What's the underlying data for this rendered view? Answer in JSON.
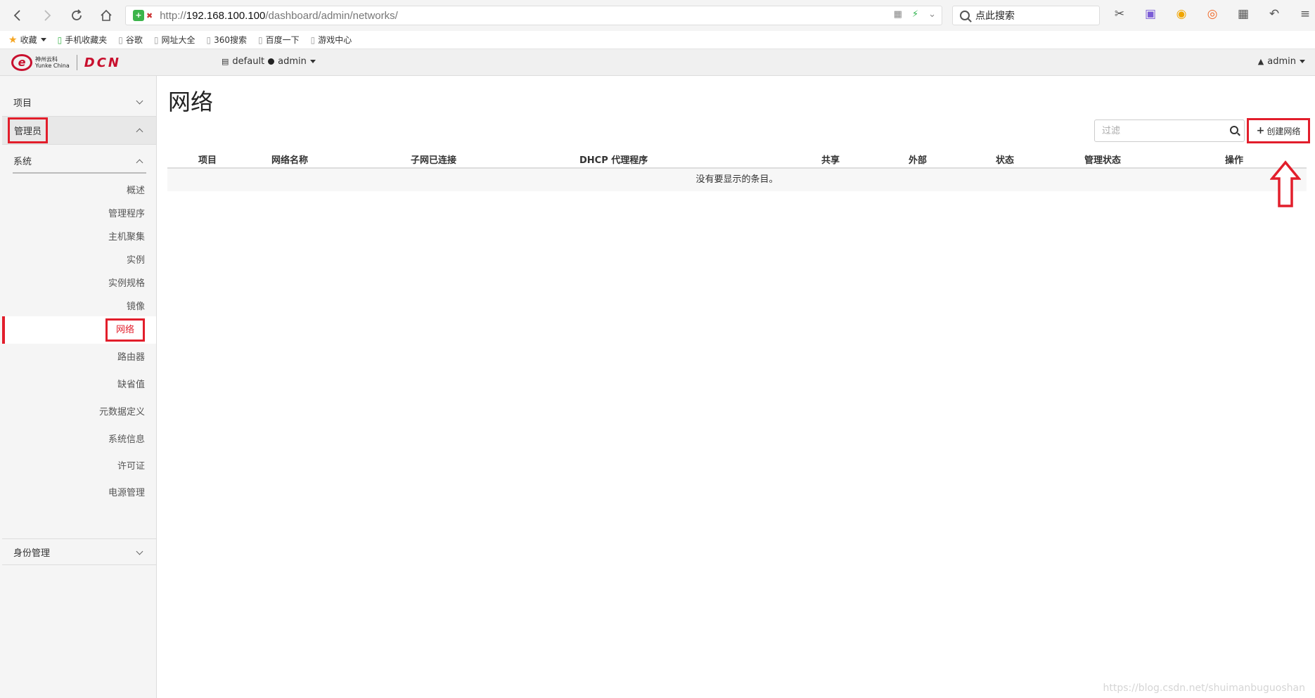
{
  "browser": {
    "url_prefix": "http://",
    "url_host": "192.168.100.100",
    "url_path": "/dashboard/admin/networks/",
    "search_placeholder": "点此搜索",
    "bookmarks": [
      "收藏",
      "手机收藏夹",
      "谷歌",
      "网址大全",
      "360搜索",
      "百度一下",
      "游戏中心"
    ]
  },
  "header": {
    "logo_cn": "神州云科",
    "logo_en": "Yunke China",
    "logo_brand": "DCN",
    "domain": "default",
    "project": "admin",
    "user": "admin"
  },
  "sidebar": {
    "project_label": "项目",
    "admin_label": "管理员",
    "system_label": "系统",
    "items": [
      "概述",
      "管理程序",
      "主机聚集",
      "实例",
      "实例规格",
      "镜像",
      "网络",
      "路由器",
      "缺省值",
      "元数据定义",
      "系统信息",
      "许可证",
      "电源管理"
    ],
    "identity_label": "身份管理"
  },
  "main": {
    "title": "网络",
    "filter_placeholder": "过滤",
    "create_button": "创建网络",
    "columns": [
      "项目",
      "网络名称",
      "子网已连接",
      "DHCP 代理程序",
      "共享",
      "外部",
      "状态",
      "管理状态",
      "操作"
    ],
    "empty_message": "没有要显示的条目。"
  },
  "watermark": "https://blog.csdn.net/shuimanbuguoshan",
  "colors": {
    "highlight": "#e21e2b",
    "brand": "#c8102e"
  }
}
